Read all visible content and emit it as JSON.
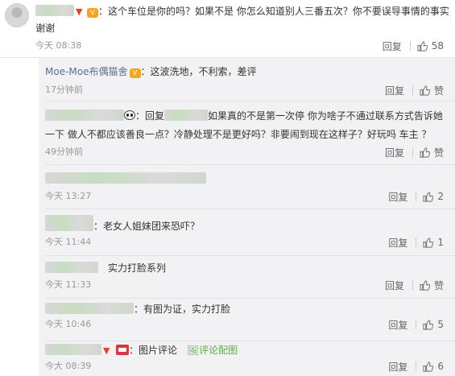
{
  "top": {
    "text_line1": "：这个车位是你的吗？如果不是 你怎么知道别人三番五次？你不要误导事情的事实",
    "text_line2": "谢谢",
    "time": "今天 08:38",
    "reply": "回复",
    "like_count": "58"
  },
  "replies": [
    {
      "user": "Moe-Moe布偶猫舍",
      "text": "：这波洗地，不利索，差评",
      "time": "17分钟前",
      "reply": "回复",
      "like": "赞"
    },
    {
      "prefix": "：回复",
      "text_line1": "如果真的不是第一次停 你为啥子不通过联系方式告诉她",
      "text_line2": "一下 做人不都应该善良一点？冷静处理不是更好吗？非要闹到现在这样子？好玩吗 车主 ？",
      "time": "49分钟前",
      "reply": "回复",
      "like": "赞"
    },
    {
      "text": "",
      "time": "今天 13:27",
      "reply": "回复",
      "like_count": "2"
    },
    {
      "text": "：老女人姐妹团来恐吓？",
      "time": "今天 11:44",
      "reply": "回复",
      "like_count": "1"
    },
    {
      "text": "实力打脸系列",
      "time": "今天 11:33",
      "reply": "回复",
      "like": "赞"
    },
    {
      "text": "：有图为证，实力打脸",
      "time": "今天 10:46",
      "reply": "回复",
      "like_count": "5"
    },
    {
      "text": "：图片评论",
      "extra": "评论配图",
      "time": "今大 08:39",
      "reply": "回复",
      "like_count": "6"
    }
  ],
  "colors": {
    "panel_bg": "#f2f2f5",
    "username": "#eb7350",
    "link_green": "#5aae47",
    "time_gray": "#999999"
  },
  "icons": {
    "thumb": "thumb-up-icon",
    "vip": "vip-badge-icon",
    "panda": "panda-emoji-icon",
    "image": "image-comment-icon",
    "reply": "reply-link"
  }
}
